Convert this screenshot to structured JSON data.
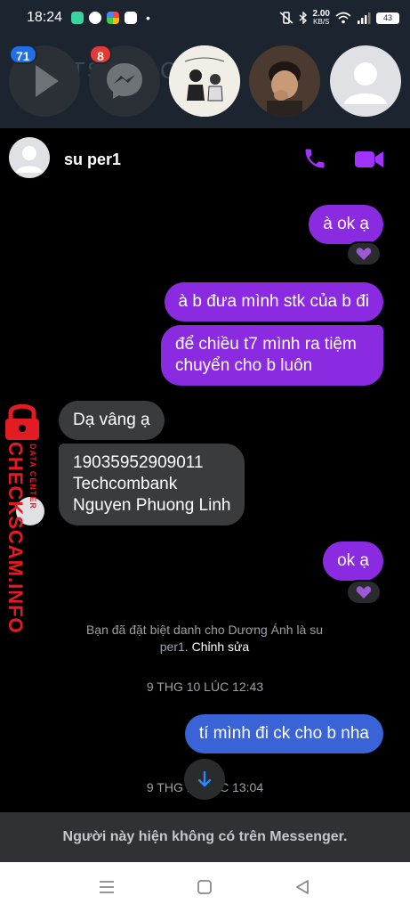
{
  "status_bar": {
    "time": "18:24",
    "net_speed_value": "2.00",
    "net_speed_unit": "KB/S",
    "battery": "43"
  },
  "heads": {
    "faded_title": "TS ABLOC",
    "badge_video": "71",
    "badge_messenger": "8"
  },
  "chat": {
    "contact_name": "su per1",
    "messages": [
      {
        "text": "à ok ạ"
      },
      {
        "text": "à b đưa mình stk của b đi"
      },
      {
        "text": "để chiều t7 mình ra tiệm chuyển cho b luôn"
      },
      {
        "text": "Dạ vâng ạ"
      },
      {
        "line1": "19035952909011",
        "line2": "Techcombank",
        "line3": "Nguyen Phuong Linh"
      },
      {
        "text": "ok ạ"
      },
      {
        "text": "tí mình đi ck cho b nha"
      }
    ],
    "system_note": "Bạn đã đặt biệt danh cho Dương Ánh là su per1.",
    "system_link": "Chỉnh sửa",
    "stamp_1": "9 THG 10 LÚC 12:43",
    "stamp_2": "9 THG 10 LÚC 13:04",
    "reaction_icon": "purple-heart-icon"
  },
  "watermark": {
    "big": "CHECKSCAM.INFO",
    "small": "DATA CENTER"
  },
  "footer": {
    "notice": "Người này hiện không có trên Messenger."
  },
  "colors": {
    "accent_purple": "#8a2be2",
    "accent_blue": "#3a63d8",
    "watermark_red": "#e31b23"
  }
}
